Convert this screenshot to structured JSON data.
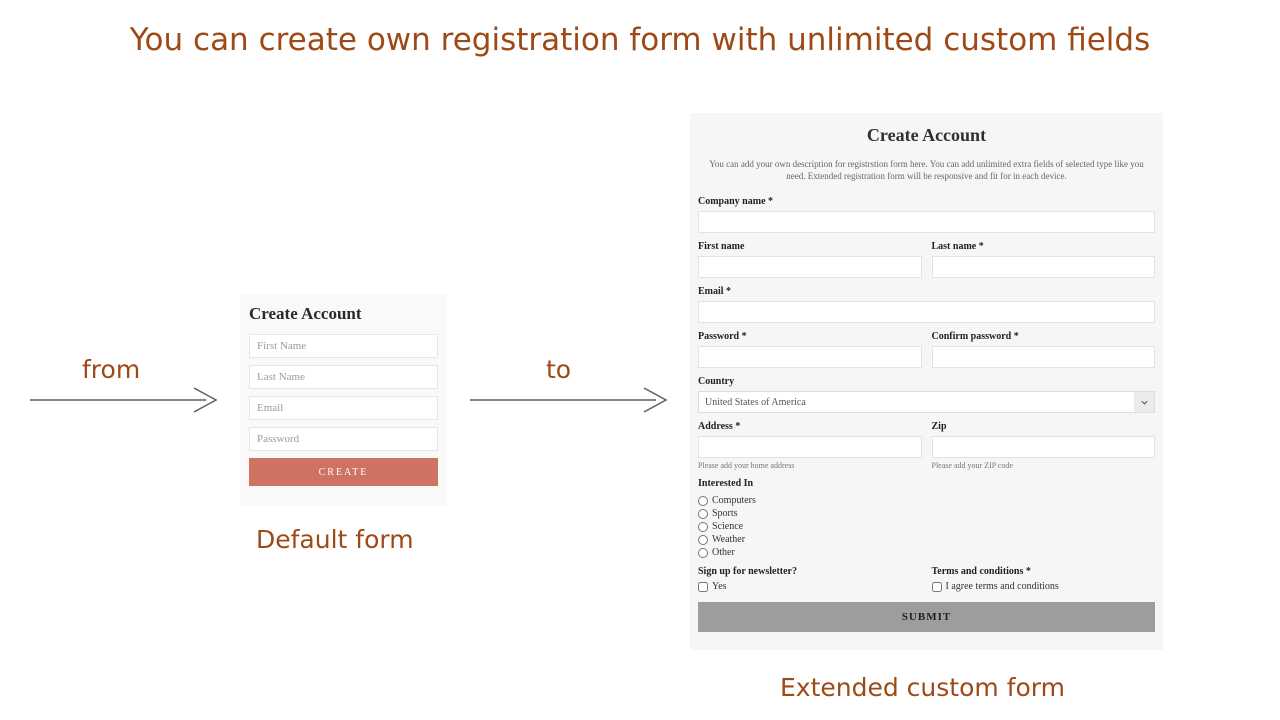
{
  "headline": "You can create own registration form with unlimited custom fields",
  "labels": {
    "from": "from",
    "to": "to",
    "default_caption": "Default form",
    "extended_caption": "Extended custom form"
  },
  "default_form": {
    "title": "Create Account",
    "first_name_ph": "First Name",
    "last_name_ph": "Last Name",
    "email_ph": "Email",
    "password_ph": "Password",
    "create_btn": "CREATE"
  },
  "extended_form": {
    "title": "Create Account",
    "description": "You can add your own description for registrstion form here. You can add unlimited extra fields of selected type like you need. Extended registration form will be responsive and fit for in each device.",
    "company_label": "Company name *",
    "first_name_label": "First name",
    "last_name_label": "Last name *",
    "email_label": "Email *",
    "password_label": "Password *",
    "confirm_label": "Confirm password *",
    "country_label": "Country",
    "country_value": "United States of America",
    "address_label": "Address *",
    "address_help": "Please add your home address",
    "zip_label": "Zip",
    "zip_help": "Please add your ZIP code",
    "interested_label": "Interested In",
    "interests": {
      "0": "Computers",
      "1": "Sports",
      "2": "Science",
      "3": "Weather",
      "4": "Other"
    },
    "newsletter_label": "Sign up for newsletter?",
    "newsletter_option": "Yes",
    "terms_label": "Terms and conditions *",
    "terms_option": "I agree terms and conditions",
    "submit_btn": "SUBMIT"
  }
}
